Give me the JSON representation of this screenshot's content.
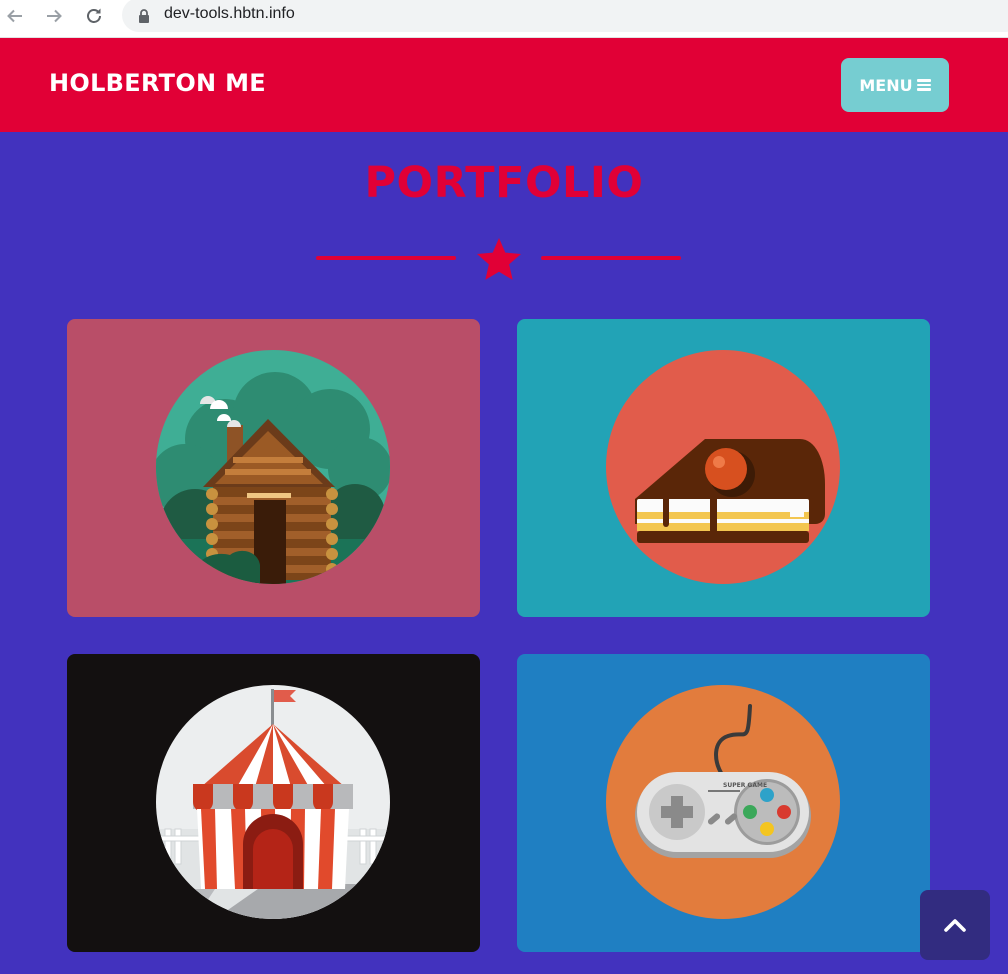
{
  "browser": {
    "url": "dev-tools.hbtn.info"
  },
  "header": {
    "brand": "HOLBERTON ME",
    "menu_label": "MENU"
  },
  "portfolio": {
    "title": "PORTFOLIO",
    "items": [
      {
        "name": "cabin",
        "bg": "#b94e68",
        "circle": "#3fae95"
      },
      {
        "name": "cake",
        "bg": "#22a3b6",
        "circle": "#e15c4b"
      },
      {
        "name": "circus",
        "bg": "#131010",
        "circle": "#eceeef"
      },
      {
        "name": "game-controller",
        "bg": "#1f7fc2",
        "circle": "#e27c3d",
        "controller_text": "SUPER GAME"
      }
    ]
  },
  "colors": {
    "accent": "#e10036",
    "page_bg": "#4232be",
    "menu_button": "#76cdd1"
  }
}
